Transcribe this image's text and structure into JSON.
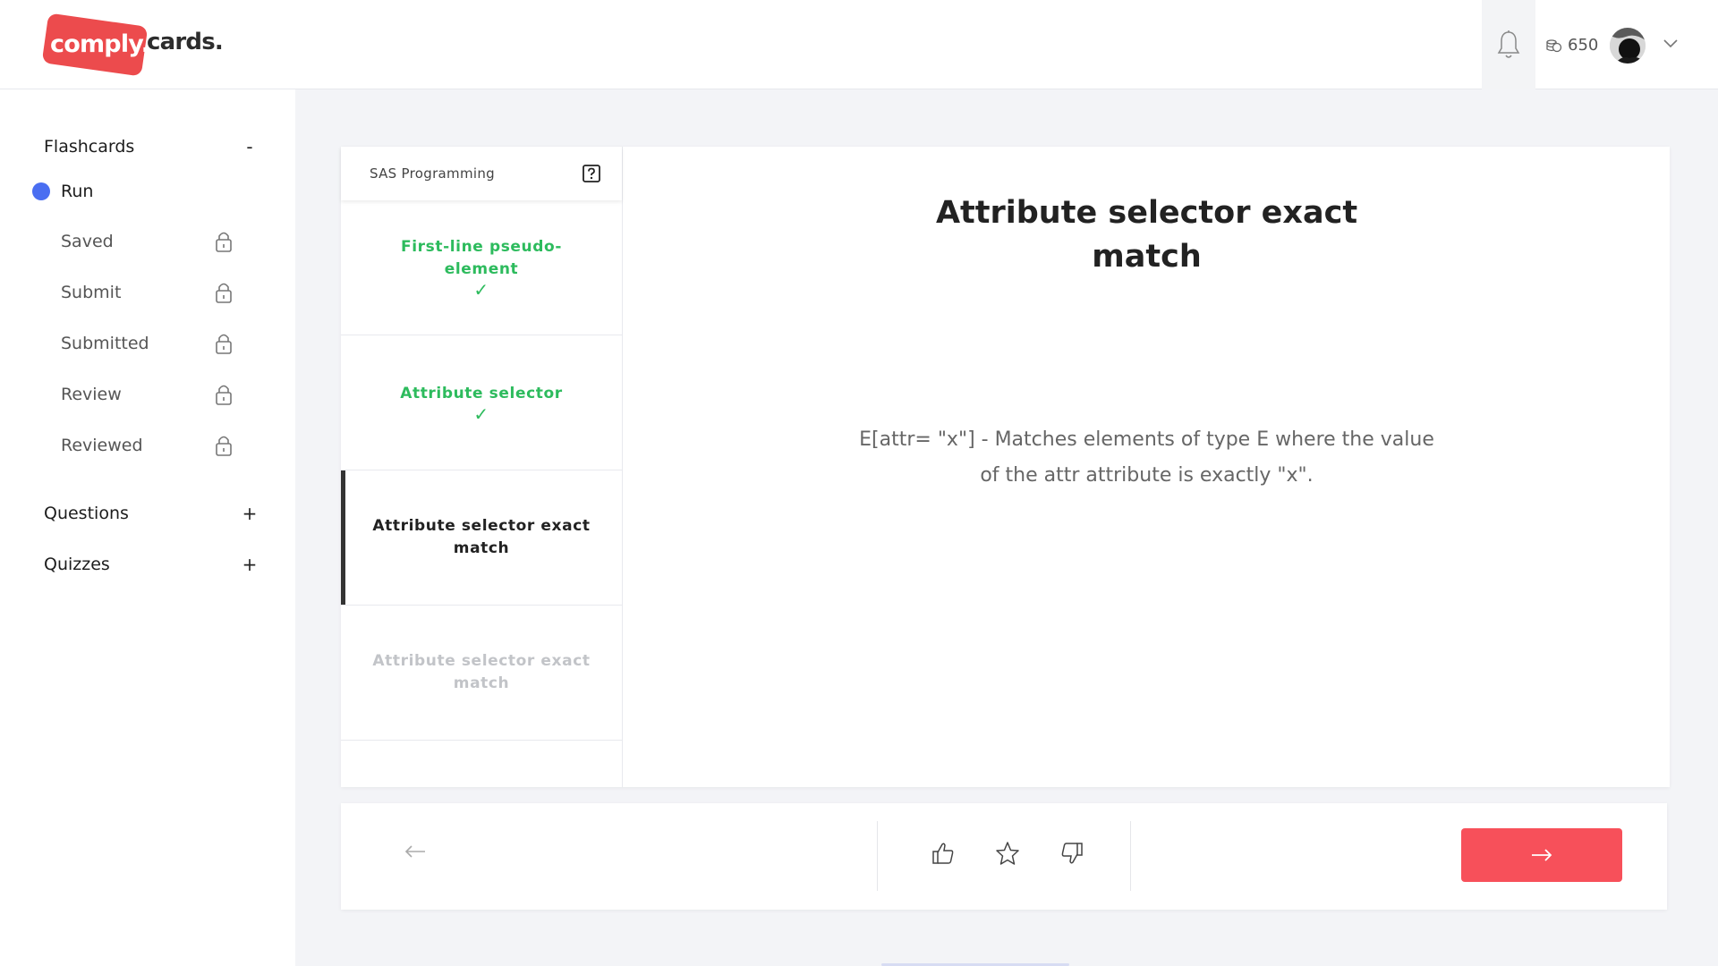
{
  "header": {
    "logo_main": "comply.",
    "logo_sub": "cards.",
    "coins": "650"
  },
  "sidebar": {
    "flashcards": {
      "label": "Flashcards",
      "toggle": "-"
    },
    "run": {
      "label": "Run"
    },
    "items": [
      {
        "label": "Saved"
      },
      {
        "label": "Submit"
      },
      {
        "label": "Submitted"
      },
      {
        "label": "Review"
      },
      {
        "label": "Reviewed"
      }
    ],
    "questions": {
      "label": "Questions",
      "toggle": "+"
    },
    "quizzes": {
      "label": "Quizzes",
      "toggle": "+"
    }
  },
  "deck": {
    "title": "SAS Programming",
    "cards": [
      {
        "label": "First-line pseudo-element",
        "status": "done",
        "check": "✓"
      },
      {
        "label": "Attribute selector",
        "status": "done",
        "check": "✓"
      },
      {
        "label": "Attribute selector exact match",
        "status": "active"
      },
      {
        "label": "Attribute selector exact match",
        "status": "pending"
      }
    ]
  },
  "card": {
    "title": "Attribute selector exact match",
    "body": "E[attr= \"x\"] - Matches elements of type E where the value of the attr attribute is exactly \"x\"."
  },
  "colors": {
    "brand": "#ec4b4d",
    "accent_blue": "#4a6ef1",
    "done_green": "#2dbb5d",
    "next_button": "#f7505a"
  }
}
